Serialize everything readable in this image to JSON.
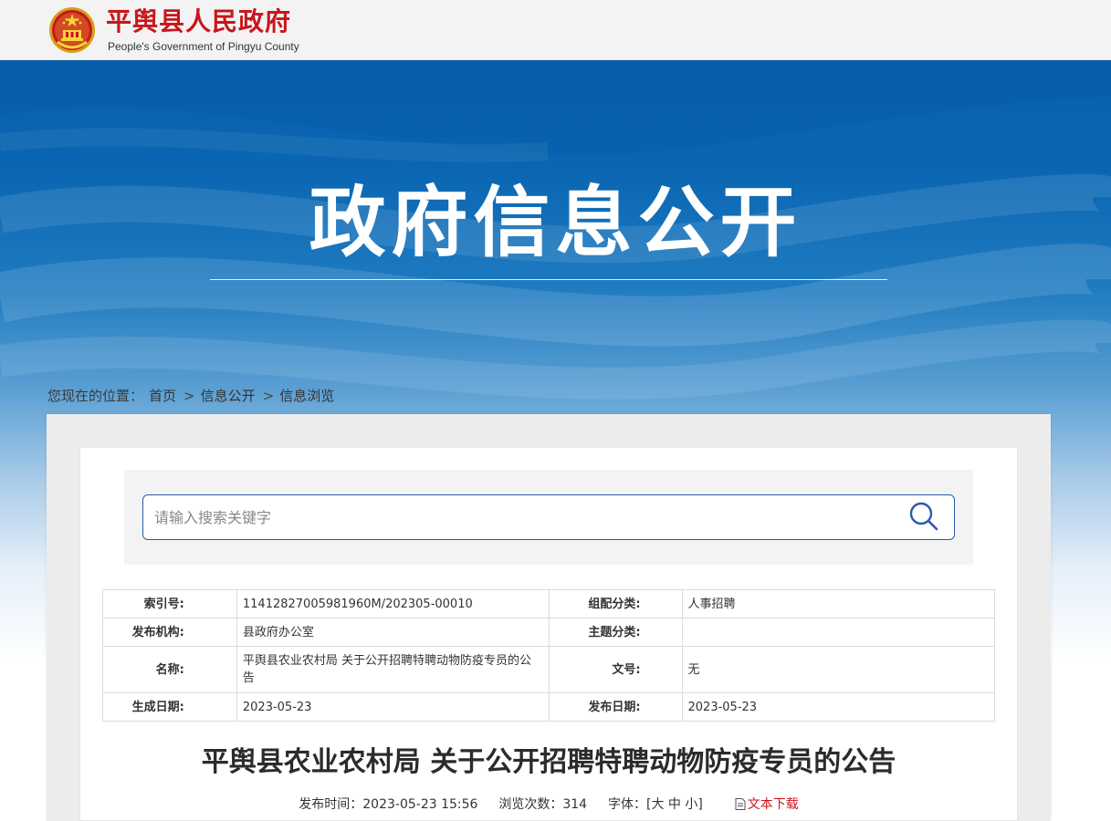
{
  "header": {
    "site_name_cn": "平舆县人民政府",
    "site_name_en": "People's Government of Pingyu County",
    "emblem_icon": "national-emblem-icon"
  },
  "banner": {
    "title": "政府信息公开"
  },
  "breadcrumb": {
    "prefix": "您现在的位置：",
    "items": [
      "首页",
      "信息公开",
      "信息浏览"
    ],
    "separator": ">"
  },
  "search": {
    "placeholder": "请输入搜索关键字",
    "value": "",
    "icon": "search-icon"
  },
  "meta_table": {
    "rows": [
      {
        "label1": "索引号:",
        "value1": "11412827005981960M/202305-00010",
        "label2": "组配分类:",
        "value2": "人事招聘"
      },
      {
        "label1": "发布机构:",
        "value1": "县政府办公室",
        "label2": "主题分类:",
        "value2": ""
      },
      {
        "label1": "名称:",
        "value1": "平舆县农业农村局 关于公开招聘特聘动物防疫专员的公告",
        "label2": "文号:",
        "value2": "无"
      },
      {
        "label1": "生成日期:",
        "value1": "2023-05-23",
        "label2": "发布日期:",
        "value2": "2023-05-23"
      }
    ]
  },
  "article": {
    "title": "平舆县农业农村局 关于公开招聘特聘动物防疫专员的公告",
    "publish_label": "发布时间：",
    "publish_time": "2023-05-23 15:56",
    "views_label": "浏览次数：",
    "views": "314",
    "font_label": "字体：",
    "font_open": "[",
    "font_large": "大",
    "font_medium": "中",
    "font_small": "小",
    "font_close": "]",
    "download_label": "文本下载",
    "download_icon": "document-icon"
  },
  "colors": {
    "brand_red": "#c8161d",
    "banner_blue": "#0a66b2",
    "search_border": "#2a5aa8"
  }
}
